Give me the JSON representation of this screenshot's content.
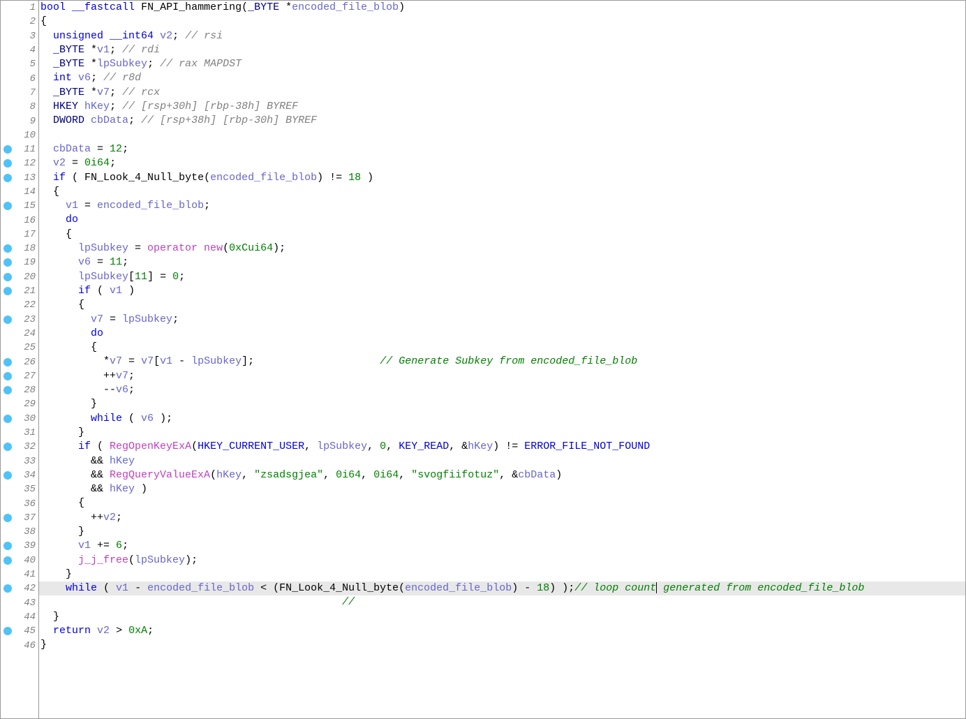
{
  "editor": {
    "total_lines": 46,
    "breakpoint_lines": [
      11,
      12,
      13,
      15,
      18,
      19,
      20,
      21,
      23,
      26,
      27,
      28,
      30,
      32,
      34,
      37,
      39,
      40,
      42,
      45
    ],
    "highlighted_line": 42,
    "lines": {
      "1": [
        {
          "t": "bool",
          "c": "kw-blue"
        },
        {
          "t": " ",
          "c": ""
        },
        {
          "t": "__fastcall",
          "c": "kw-blue"
        },
        {
          "t": " ",
          "c": ""
        },
        {
          "t": "FN_API_hammering",
          "c": "kw-func"
        },
        {
          "t": "(",
          "c": ""
        },
        {
          "t": "_BYTE",
          "c": "kw-navy"
        },
        {
          "t": " *",
          "c": ""
        },
        {
          "t": "encoded_file_blob",
          "c": "kw-var"
        },
        {
          "t": ")",
          "c": ""
        }
      ],
      "2": [
        {
          "t": "{",
          "c": ""
        }
      ],
      "3": [
        {
          "t": "  ",
          "c": ""
        },
        {
          "t": "unsigned",
          "c": "kw-blue"
        },
        {
          "t": " ",
          "c": ""
        },
        {
          "t": "__int64",
          "c": "kw-blue"
        },
        {
          "t": " ",
          "c": ""
        },
        {
          "t": "v2",
          "c": "kw-var"
        },
        {
          "t": "; ",
          "c": ""
        },
        {
          "t": "// rsi",
          "c": "kw-cmt"
        }
      ],
      "4": [
        {
          "t": "  ",
          "c": ""
        },
        {
          "t": "_BYTE",
          "c": "kw-navy"
        },
        {
          "t": " *",
          "c": ""
        },
        {
          "t": "v1",
          "c": "kw-var"
        },
        {
          "t": "; ",
          "c": ""
        },
        {
          "t": "// rdi",
          "c": "kw-cmt"
        }
      ],
      "5": [
        {
          "t": "  ",
          "c": ""
        },
        {
          "t": "_BYTE",
          "c": "kw-navy"
        },
        {
          "t": " *",
          "c": ""
        },
        {
          "t": "lpSubkey",
          "c": "kw-var"
        },
        {
          "t": "; ",
          "c": ""
        },
        {
          "t": "// rax MAPDST",
          "c": "kw-cmt"
        }
      ],
      "6": [
        {
          "t": "  ",
          "c": ""
        },
        {
          "t": "int",
          "c": "kw-blue"
        },
        {
          "t": " ",
          "c": ""
        },
        {
          "t": "v6",
          "c": "kw-var"
        },
        {
          "t": "; ",
          "c": ""
        },
        {
          "t": "// r8d",
          "c": "kw-cmt"
        }
      ],
      "7": [
        {
          "t": "  ",
          "c": ""
        },
        {
          "t": "_BYTE",
          "c": "kw-navy"
        },
        {
          "t": " *",
          "c": ""
        },
        {
          "t": "v7",
          "c": "kw-var"
        },
        {
          "t": "; ",
          "c": ""
        },
        {
          "t": "// rcx",
          "c": "kw-cmt"
        }
      ],
      "8": [
        {
          "t": "  ",
          "c": ""
        },
        {
          "t": "HKEY",
          "c": "kw-navy"
        },
        {
          "t": " ",
          "c": ""
        },
        {
          "t": "hKey",
          "c": "kw-var"
        },
        {
          "t": "; ",
          "c": ""
        },
        {
          "t": "// [rsp+30h] [rbp-38h] BYREF",
          "c": "kw-cmt"
        }
      ],
      "9": [
        {
          "t": "  ",
          "c": ""
        },
        {
          "t": "DWORD",
          "c": "kw-navy"
        },
        {
          "t": " ",
          "c": ""
        },
        {
          "t": "cbData",
          "c": "kw-var"
        },
        {
          "t": "; ",
          "c": ""
        },
        {
          "t": "// [rsp+38h] [rbp-30h] BYREF",
          "c": "kw-cmt"
        }
      ],
      "10": [
        {
          "t": "",
          "c": ""
        }
      ],
      "11": [
        {
          "t": "  ",
          "c": ""
        },
        {
          "t": "cbData",
          "c": "kw-var"
        },
        {
          "t": " = ",
          "c": ""
        },
        {
          "t": "12",
          "c": "kw-green"
        },
        {
          "t": ";",
          "c": ""
        }
      ],
      "12": [
        {
          "t": "  ",
          "c": ""
        },
        {
          "t": "v2",
          "c": "kw-var"
        },
        {
          "t": " = ",
          "c": ""
        },
        {
          "t": "0i64",
          "c": "kw-green"
        },
        {
          "t": ";",
          "c": ""
        }
      ],
      "13": [
        {
          "t": "  ",
          "c": ""
        },
        {
          "t": "if",
          "c": "kw-blue"
        },
        {
          "t": " ( ",
          "c": ""
        },
        {
          "t": "FN_Look_4_Null_byte",
          "c": "kw-func"
        },
        {
          "t": "(",
          "c": ""
        },
        {
          "t": "encoded_file_blob",
          "c": "kw-var"
        },
        {
          "t": ") != ",
          "c": ""
        },
        {
          "t": "18",
          "c": "kw-green"
        },
        {
          "t": " )",
          "c": ""
        }
      ],
      "14": [
        {
          "t": "  {",
          "c": ""
        }
      ],
      "15": [
        {
          "t": "    ",
          "c": ""
        },
        {
          "t": "v1",
          "c": "kw-var"
        },
        {
          "t": " = ",
          "c": ""
        },
        {
          "t": "encoded_file_blob",
          "c": "kw-var"
        },
        {
          "t": ";",
          "c": ""
        }
      ],
      "16": [
        {
          "t": "    ",
          "c": ""
        },
        {
          "t": "do",
          "c": "kw-blue"
        }
      ],
      "17": [
        {
          "t": "    {",
          "c": ""
        }
      ],
      "18": [
        {
          "t": "      ",
          "c": ""
        },
        {
          "t": "lpSubkey",
          "c": "kw-var"
        },
        {
          "t": " = ",
          "c": ""
        },
        {
          "t": "operator new",
          "c": "kw-pink"
        },
        {
          "t": "(",
          "c": ""
        },
        {
          "t": "0xCui64",
          "c": "kw-green"
        },
        {
          "t": ");",
          "c": ""
        }
      ],
      "19": [
        {
          "t": "      ",
          "c": ""
        },
        {
          "t": "v6",
          "c": "kw-var"
        },
        {
          "t": " = ",
          "c": ""
        },
        {
          "t": "11",
          "c": "kw-green"
        },
        {
          "t": ";",
          "c": ""
        }
      ],
      "20": [
        {
          "t": "      ",
          "c": ""
        },
        {
          "t": "lpSubkey",
          "c": "kw-var"
        },
        {
          "t": "[",
          "c": ""
        },
        {
          "t": "11",
          "c": "kw-green"
        },
        {
          "t": "] = ",
          "c": ""
        },
        {
          "t": "0",
          "c": "kw-green"
        },
        {
          "t": ";",
          "c": ""
        }
      ],
      "21": [
        {
          "t": "      ",
          "c": ""
        },
        {
          "t": "if",
          "c": "kw-blue"
        },
        {
          "t": " ( ",
          "c": ""
        },
        {
          "t": "v1",
          "c": "kw-var"
        },
        {
          "t": " )",
          "c": ""
        }
      ],
      "22": [
        {
          "t": "      {",
          "c": ""
        }
      ],
      "23": [
        {
          "t": "        ",
          "c": ""
        },
        {
          "t": "v7",
          "c": "kw-var"
        },
        {
          "t": " = ",
          "c": ""
        },
        {
          "t": "lpSubkey",
          "c": "kw-var"
        },
        {
          "t": ";",
          "c": ""
        }
      ],
      "24": [
        {
          "t": "        ",
          "c": ""
        },
        {
          "t": "do",
          "c": "kw-blue"
        }
      ],
      "25": [
        {
          "t": "        {",
          "c": ""
        }
      ],
      "26": [
        {
          "t": "          *",
          "c": ""
        },
        {
          "t": "v7",
          "c": "kw-var"
        },
        {
          "t": " = ",
          "c": ""
        },
        {
          "t": "v7",
          "c": "kw-var"
        },
        {
          "t": "[",
          "c": ""
        },
        {
          "t": "v1",
          "c": "kw-var"
        },
        {
          "t": " - ",
          "c": ""
        },
        {
          "t": "lpSubkey",
          "c": "kw-var"
        },
        {
          "t": "];                    ",
          "c": ""
        },
        {
          "t": "// Generate Subkey from encoded_file_blob",
          "c": "kw-cmt-green"
        }
      ],
      "27": [
        {
          "t": "          ++",
          "c": ""
        },
        {
          "t": "v7",
          "c": "kw-var"
        },
        {
          "t": ";",
          "c": ""
        }
      ],
      "28": [
        {
          "t": "          --",
          "c": ""
        },
        {
          "t": "v6",
          "c": "kw-var"
        },
        {
          "t": ";",
          "c": ""
        }
      ],
      "29": [
        {
          "t": "        }",
          "c": ""
        }
      ],
      "30": [
        {
          "t": "        ",
          "c": ""
        },
        {
          "t": "while",
          "c": "kw-blue"
        },
        {
          "t": " ( ",
          "c": ""
        },
        {
          "t": "v6",
          "c": "kw-var"
        },
        {
          "t": " );",
          "c": ""
        }
      ],
      "31": [
        {
          "t": "      }",
          "c": ""
        }
      ],
      "32": [
        {
          "t": "      ",
          "c": ""
        },
        {
          "t": "if",
          "c": "kw-blue"
        },
        {
          "t": " ( ",
          "c": ""
        },
        {
          "t": "RegOpenKeyExA",
          "c": "kw-pink"
        },
        {
          "t": "(",
          "c": ""
        },
        {
          "t": "HKEY_CURRENT_USER",
          "c": "kw-const"
        },
        {
          "t": ", ",
          "c": ""
        },
        {
          "t": "lpSubkey",
          "c": "kw-var"
        },
        {
          "t": ", ",
          "c": ""
        },
        {
          "t": "0",
          "c": "kw-green"
        },
        {
          "t": ", ",
          "c": ""
        },
        {
          "t": "KEY_READ",
          "c": "kw-const"
        },
        {
          "t": ", &",
          "c": ""
        },
        {
          "t": "hKey",
          "c": "kw-var"
        },
        {
          "t": ") != ",
          "c": ""
        },
        {
          "t": "ERROR_FILE_NOT_FOUND",
          "c": "kw-const"
        }
      ],
      "33": [
        {
          "t": "        && ",
          "c": ""
        },
        {
          "t": "hKey",
          "c": "kw-var"
        }
      ],
      "34": [
        {
          "t": "        && ",
          "c": ""
        },
        {
          "t": "RegQueryValueExA",
          "c": "kw-pink"
        },
        {
          "t": "(",
          "c": ""
        },
        {
          "t": "hKey",
          "c": "kw-var"
        },
        {
          "t": ", ",
          "c": ""
        },
        {
          "t": "\"zsadsgjea\"",
          "c": "kw-green"
        },
        {
          "t": ", ",
          "c": ""
        },
        {
          "t": "0i64",
          "c": "kw-green"
        },
        {
          "t": ", ",
          "c": ""
        },
        {
          "t": "0i64",
          "c": "kw-green"
        },
        {
          "t": ", ",
          "c": ""
        },
        {
          "t": "\"svogfiifotuz\"",
          "c": "kw-green"
        },
        {
          "t": ", &",
          "c": ""
        },
        {
          "t": "cbData",
          "c": "kw-var"
        },
        {
          "t": ")",
          "c": ""
        }
      ],
      "35": [
        {
          "t": "        && ",
          "c": ""
        },
        {
          "t": "hKey",
          "c": "kw-var"
        },
        {
          "t": " )",
          "c": ""
        }
      ],
      "36": [
        {
          "t": "      {",
          "c": ""
        }
      ],
      "37": [
        {
          "t": "        ++",
          "c": ""
        },
        {
          "t": "v2",
          "c": "kw-var"
        },
        {
          "t": ";",
          "c": ""
        }
      ],
      "38": [
        {
          "t": "      }",
          "c": ""
        }
      ],
      "39": [
        {
          "t": "      ",
          "c": ""
        },
        {
          "t": "v1",
          "c": "kw-var"
        },
        {
          "t": " += ",
          "c": ""
        },
        {
          "t": "6",
          "c": "kw-green"
        },
        {
          "t": ";",
          "c": ""
        }
      ],
      "40": [
        {
          "t": "      ",
          "c": ""
        },
        {
          "t": "j_j_free",
          "c": "kw-pink"
        },
        {
          "t": "(",
          "c": ""
        },
        {
          "t": "lpSubkey",
          "c": "kw-var"
        },
        {
          "t": ");",
          "c": ""
        }
      ],
      "41": [
        {
          "t": "    }",
          "c": ""
        }
      ],
      "42": [
        {
          "t": "    ",
          "c": ""
        },
        {
          "t": "while",
          "c": "kw-blue"
        },
        {
          "t": " ( ",
          "c": ""
        },
        {
          "t": "v1",
          "c": "kw-var"
        },
        {
          "t": " - ",
          "c": ""
        },
        {
          "t": "encoded_file_blob",
          "c": "kw-var"
        },
        {
          "t": " < (",
          "c": ""
        },
        {
          "t": "FN_Look_4_Null_byte",
          "c": "kw-func"
        },
        {
          "t": "(",
          "c": ""
        },
        {
          "t": "encoded_file_blob",
          "c": "kw-var"
        },
        {
          "t": ") - ",
          "c": ""
        },
        {
          "t": "18",
          "c": "kw-green"
        },
        {
          "t": ") );",
          "c": ""
        },
        {
          "t": "// loop count",
          "c": "kw-cmt-green"
        },
        {
          "cursor": true
        },
        {
          "t": " generated from encoded_file_blob",
          "c": "kw-cmt-green"
        }
      ],
      "43": [
        {
          "t": "                                                ",
          "c": ""
        },
        {
          "t": "// ",
          "c": "kw-cmt-green"
        }
      ],
      "44": [
        {
          "t": "  }",
          "c": ""
        }
      ],
      "45": [
        {
          "t": "  ",
          "c": ""
        },
        {
          "t": "return",
          "c": "kw-blue"
        },
        {
          "t": " ",
          "c": ""
        },
        {
          "t": "v2",
          "c": "kw-var"
        },
        {
          "t": " > ",
          "c": ""
        },
        {
          "t": "0xA",
          "c": "kw-green"
        },
        {
          "t": ";",
          "c": ""
        }
      ],
      "46": [
        {
          "t": "}",
          "c": ""
        }
      ]
    }
  }
}
